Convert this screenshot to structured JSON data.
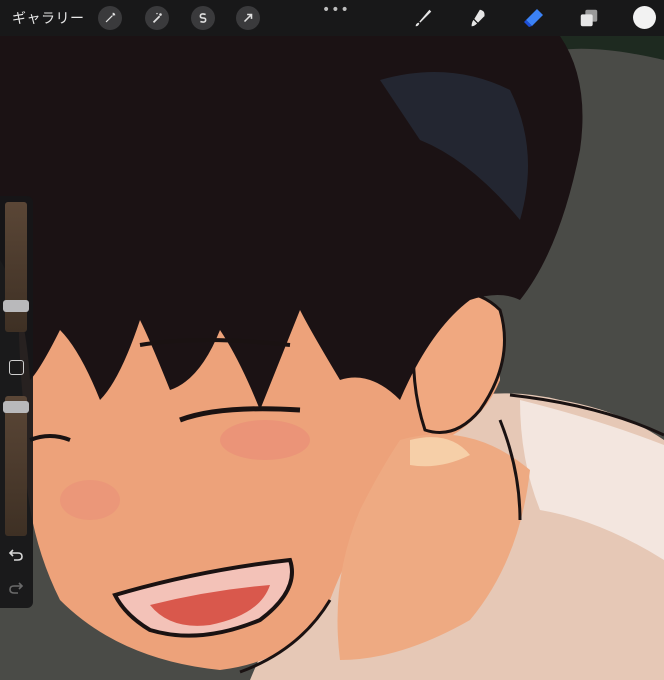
{
  "toolbar": {
    "gallery_label": "ギャラリー",
    "more_label": "•••"
  },
  "icons": {
    "settings": "wrench-icon",
    "adjustments": "magic-wand-icon",
    "selection": "selection-s-icon",
    "transform": "arrow-cursor-icon",
    "brush": "brush-icon",
    "smudge": "smudge-icon",
    "eraser": "eraser-icon",
    "layers": "layers-icon",
    "color": "color-well",
    "modify": "square-icon",
    "undo": "undo-icon",
    "redo": "redo-icon"
  },
  "colors": {
    "active_tool": "#3b82f6",
    "current_color": "#f2f2f2",
    "toolbar_bg": "#141416"
  }
}
